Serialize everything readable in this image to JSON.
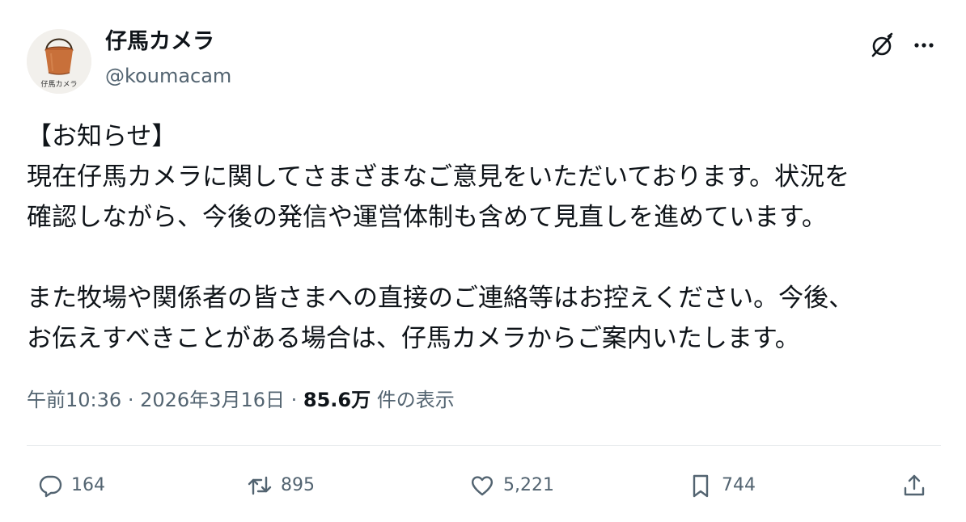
{
  "post": {
    "author": {
      "display_name": "仔馬カメラ",
      "handle": "@koumacam",
      "avatar_caption": "仔馬カメラ"
    },
    "body_lines": [
      "【お知らせ】",
      "現在仔馬カメラに関してさまざまなご意見をいただいております。状況を",
      "確認しながら、今後の発信や運営体制も含めて見直しを進めています。",
      "また牧場や関係者の皆さまへの直接のご連絡等はお控えください。今後、",
      "お伝えすべきことがある場合は、仔馬カメラからご案内いたします。"
    ],
    "meta": {
      "time": "午前10:36",
      "separator": "·",
      "date": "2026年3月16日",
      "views": "85.6万",
      "views_label": "件の表示"
    },
    "actions": {
      "replies": "164",
      "reposts": "895",
      "likes": "5,221",
      "bookmarks": "744"
    },
    "icons": {
      "grok": "grok-icon",
      "more": "more-icon",
      "reply": "reply-icon",
      "repost": "repost-icon",
      "like": "heart-icon",
      "bookmark": "bookmark-icon",
      "share": "share-icon"
    },
    "colors": {
      "text": "#0f1419",
      "secondary": "#536471",
      "divider": "#e6e9ec"
    }
  }
}
